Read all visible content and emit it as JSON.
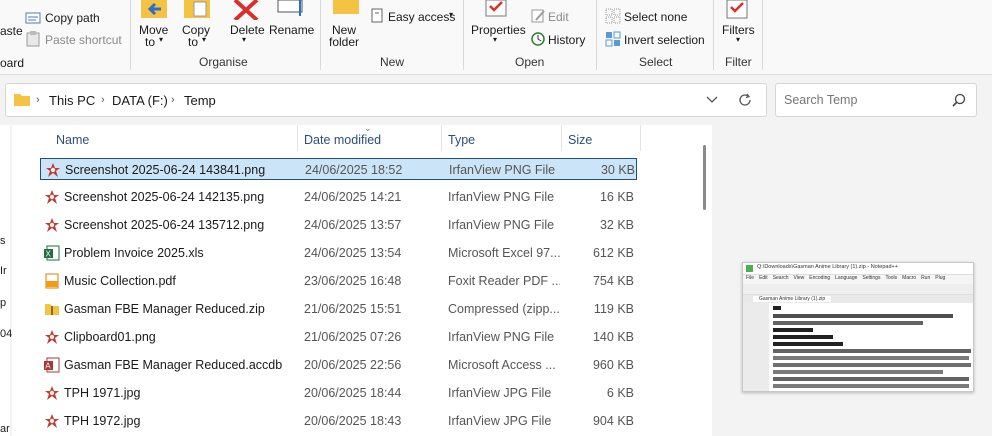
{
  "ribbon": {
    "clipboard": {
      "copy_path": "Copy path",
      "paste_shortcut": "Paste shortcut",
      "paste_partial": "aste",
      "group_partial": "oard"
    },
    "organise": {
      "move_to": [
        "Move",
        "to"
      ],
      "copy_to": [
        "Copy",
        "to"
      ],
      "delete": "Delete",
      "rename": "Rename",
      "group": "Organise"
    },
    "new": {
      "new_folder": [
        "New",
        "folder"
      ],
      "easy_access": "Easy access",
      "group": "New"
    },
    "open": {
      "properties": "Properties",
      "edit": "Edit",
      "history": "History",
      "group": "Open"
    },
    "select": {
      "select_none": "Select none",
      "invert_selection": "Invert selection",
      "group": "Select"
    },
    "filter": {
      "filters": "Filters",
      "group": "Filter"
    }
  },
  "address": {
    "crumbs": [
      "This PC",
      "DATA (F:)",
      "Temp"
    ]
  },
  "search": {
    "placeholder": "Search Temp"
  },
  "columns": {
    "name": "Name",
    "date": "Date modified",
    "type": "Type",
    "size": "Size"
  },
  "files": [
    {
      "name": "Screenshot 2025-06-24 143841.png",
      "date": "24/06/2025 18:52",
      "type": "IrfanView PNG File",
      "size": "30 KB",
      "icon": "irfanview-icon",
      "selected": true
    },
    {
      "name": "Screenshot 2025-06-24 142135.png",
      "date": "24/06/2025 14:21",
      "type": "IrfanView PNG File",
      "size": "16 KB",
      "icon": "irfanview-icon"
    },
    {
      "name": "Screenshot 2025-06-24 135712.png",
      "date": "24/06/2025 13:57",
      "type": "IrfanView PNG File",
      "size": "32 KB",
      "icon": "irfanview-icon"
    },
    {
      "name": "Problem Invoice 2025.xls",
      "date": "24/06/2025 13:54",
      "type": "Microsoft Excel 97...",
      "size": "612 KB",
      "icon": "excel-icon"
    },
    {
      "name": "Music Collection.pdf",
      "date": "23/06/2025 16:48",
      "type": "Foxit Reader PDF ...",
      "size": "754 KB",
      "icon": "pdf-icon"
    },
    {
      "name": "Gasman FBE Manager Reduced.zip",
      "date": "21/06/2025 15:51",
      "type": "Compressed (zipp...",
      "size": "119 KB",
      "icon": "zip-folder-icon"
    },
    {
      "name": "Clipboard01.png",
      "date": "21/06/2025 07:26",
      "type": "IrfanView PNG File",
      "size": "140 KB",
      "icon": "irfanview-icon"
    },
    {
      "name": "Gasman FBE Manager Reduced.accdb",
      "date": "20/06/2025 22:56",
      "type": "Microsoft Access ...",
      "size": "960 KB",
      "icon": "access-icon"
    },
    {
      "name": "TPH 1971.jpg",
      "date": "20/06/2025 18:44",
      "type": "IrfanView JPG File",
      "size": "6 KB",
      "icon": "irfanview-icon"
    },
    {
      "name": "TPH 1972.jpg",
      "date": "20/06/2025 18:43",
      "type": "IrfanView JPG File",
      "size": "904 KB",
      "icon": "irfanview-icon"
    }
  ],
  "nav_partial": [
    "s",
    "Ir",
    "p",
    "04",
    "ar"
  ],
  "preview": {
    "title": "Q:\\Downloads\\Gasman Anime Library (1).zip - Notepad++",
    "menu": [
      "File",
      "Edit",
      "Search",
      "View",
      "Encoding",
      "Language",
      "Settings",
      "Tools",
      "Macro",
      "Run",
      "Plug"
    ],
    "tab": "Gasman Anime Library (1).zip"
  }
}
